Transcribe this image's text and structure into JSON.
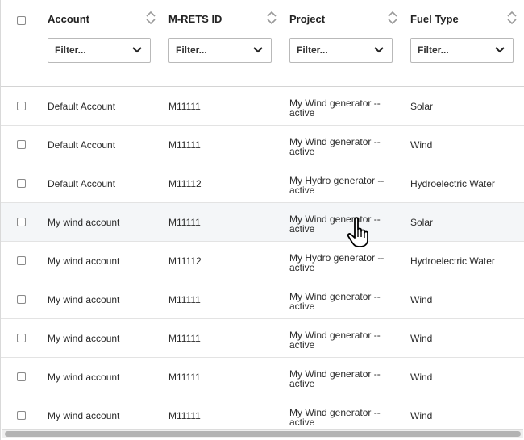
{
  "columns": [
    {
      "label": "Account",
      "filter": "Filter..."
    },
    {
      "label": "M-RETS ID",
      "filter": "Filter..."
    },
    {
      "label": "Project",
      "filter": "Filter..."
    },
    {
      "label": "Fuel Type",
      "filter": "Filter..."
    }
  ],
  "rows": [
    {
      "account": "Default Account",
      "mrets_id": "M11111",
      "project": "My Wind generator -- active",
      "fuel": "Solar"
    },
    {
      "account": "Default Account",
      "mrets_id": "M11111",
      "project": "My Wind generator -- active",
      "fuel": "Wind"
    },
    {
      "account": "Default Account",
      "mrets_id": "M11112",
      "project": "My Hydro generator -- active",
      "fuel": "Hydroelectric Water"
    },
    {
      "account": "My wind account",
      "mrets_id": "M11111",
      "project": "My Wind generator -- active",
      "fuel": "Solar"
    },
    {
      "account": "My wind account",
      "mrets_id": "M11112",
      "project": "My Hydro generator -- active",
      "fuel": "Hydroelectric Water"
    },
    {
      "account": "My wind account",
      "mrets_id": "M11111",
      "project": "My Wind generator -- active",
      "fuel": "Wind"
    },
    {
      "account": "My wind account",
      "mrets_id": "M11111",
      "project": "My Wind generator -- active",
      "fuel": "Wind"
    },
    {
      "account": "My wind account",
      "mrets_id": "M11111",
      "project": "My Wind generator -- active",
      "fuel": "Wind"
    },
    {
      "account": "My wind account",
      "mrets_id": "M11111",
      "project": "My Wind generator -- active",
      "fuel": "Wind"
    }
  ],
  "hovered_row": 3,
  "icons": {
    "sort": "sort-arrows-icon",
    "filter_dropdown": "chevron-down-icon",
    "cursor": "hand-pointer-cursor-icon"
  },
  "colors": {
    "border": "#d9d9d9",
    "row_hover": "#f4f6f8",
    "text": "#2b2b2b"
  }
}
